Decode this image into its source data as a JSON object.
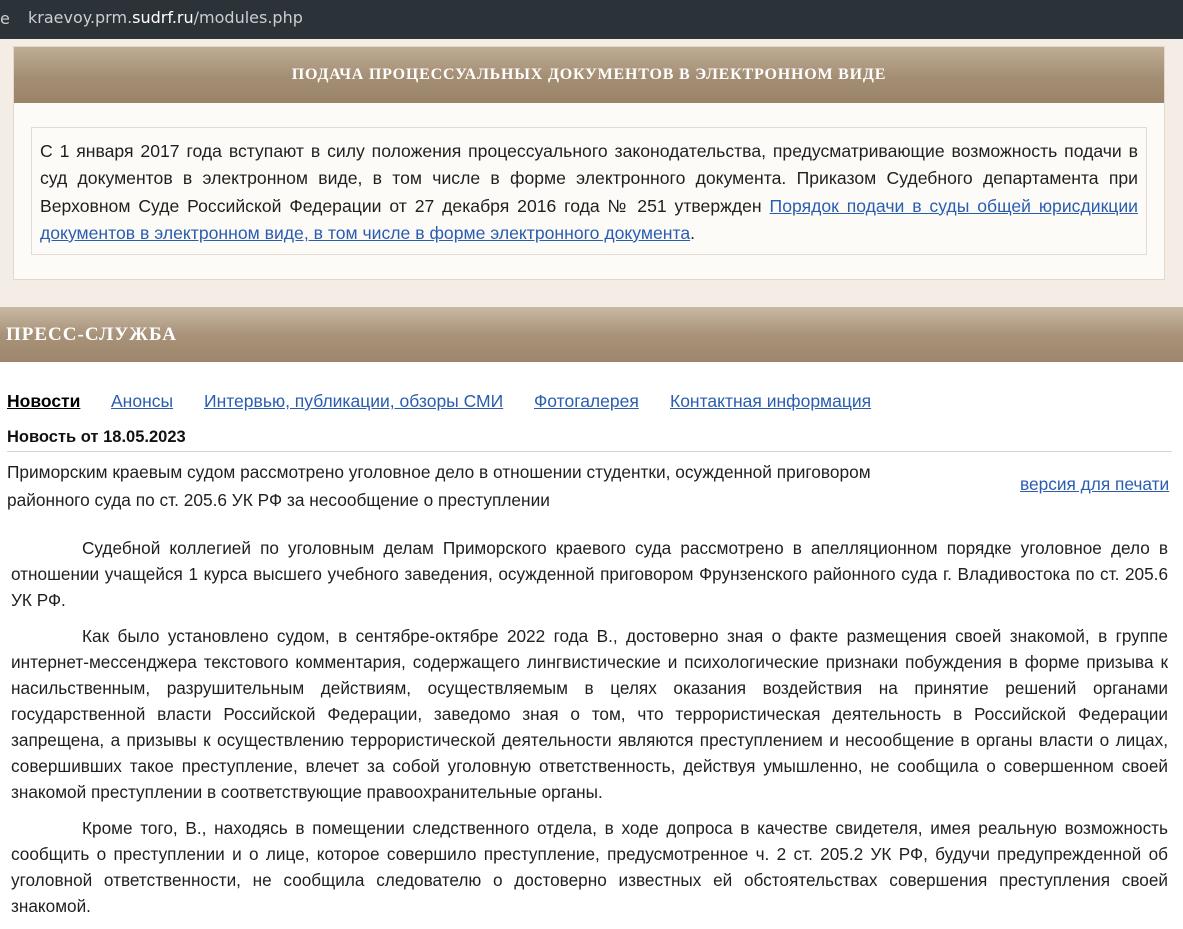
{
  "browser": {
    "url_prefix": "kraevoy.prm.",
    "url_host": "sudrf.ru",
    "url_path": "/modules.php",
    "edge_char": "e"
  },
  "notice_card": {
    "title": "ПОДАЧА ПРОЦЕССУАЛЬНЫХ ДОКУМЕНТОВ В ЭЛЕКТРОННОМ ВИДЕ",
    "text": "С 1 января 2017 года вступают в силу положения процессуального законодательства, предусматривающие возможность подачи в суд документов в электронном виде, в том числе в форме электронного документа. Приказом Судебного департамента при Верховном Суде Российской Федерации от 27 декабря 2016 года № 251 утвержден ",
    "link": "Порядок подачи в суды общей юрисдикции документов в электронном виде, в том числе в форме электронного документа",
    "text_end": "."
  },
  "press": {
    "title": "ПРЕСС-СЛУЖБА",
    "tabs": [
      {
        "label": "Новости",
        "active": true
      },
      {
        "label": "Анонсы",
        "active": false
      },
      {
        "label": "Интервью, публикации, обзоры СМИ",
        "active": false
      },
      {
        "label": "Фотогалерея",
        "active": false
      },
      {
        "label": "Контактная информация",
        "active": false
      }
    ]
  },
  "news": {
    "date_label": "Новость от 18.05.2023",
    "title": "Приморским краевым судом рассмотрено уголовное дело в отношении студентки, осужденной приговором районного суда по ст. 205.6 УК РФ за несообщение о преступлении",
    "print_link": "версия для печати",
    "paragraphs": [
      "Судебной коллегией по уголовным делам Приморского краевого суда рассмотрено в апелляционном порядке уголовное дело в отношении учащейся 1 курса высшего учебного заведения, осужденной приговором Фрунзенского районного суда г. Владивостока по ст. 205.6 УК РФ.",
      "Как было установлено судом, в сентябре-октябре 2022 года В., достоверно зная о факте размещения своей знакомой, в группе интернет-мессенджера текстового комментария, содержащего лингвистические и психологические признаки побуждения в форме призыва к насильственным, разрушительным действиям, осуществляемым в целях оказания воздействия на принятие решений органами государственной власти Российской Федерации, заведомо зная о том, что террористическая деятельность в Российской Федерации запрещена, а призывы к осуществлению террористической деятельности являются преступлением и несообщение в органы власти о лицах, совершивших такое преступление, влечет за собой уголовную ответственность, действуя умышленно, не сообщила о совершенном своей знакомой преступлении в соответствующие правоохранительные органы.",
      "Кроме того, В., находясь в помещении следственного отдела, в ходе допроса в качестве свидетеля, имея реальную возможность сообщить о преступлении и о лице, которое совершило преступление, предусмотренное ч. 2 ст. 205.2 УК РФ, будучи предупрежденной об уголовной ответственности, не сообщила следователю о достоверно известных ей обстоятельствах совершения преступления своей знакомой."
    ]
  }
}
